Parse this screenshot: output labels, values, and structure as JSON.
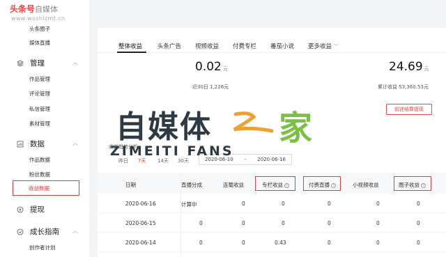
{
  "brand": {
    "logo": "头条号",
    "rest": "自媒体",
    "site": "www.woshizmt.cn"
  },
  "sidebar": {
    "top_items": [
      "头条圈子",
      "媒体直播"
    ],
    "groups": [
      {
        "label": "管理",
        "icon": "layers-icon",
        "items": [
          "作品管理",
          "评论管理",
          "私信管理",
          "素材管理"
        ]
      },
      {
        "label": "数据",
        "icon": "chart-icon",
        "items": [
          "作品数据",
          "粉丝数据",
          "收益数据"
        ]
      },
      {
        "label": "提现",
        "icon": "money-icon",
        "items": []
      },
      {
        "label": "成长指南",
        "icon": "growth-icon",
        "items": [
          "创作者计划"
        ]
      }
    ],
    "active_item": "收益数据"
  },
  "tabs": [
    "整体收益",
    "头条广告",
    "视频收益",
    "付费专栏",
    "番茄小说",
    "更多收益"
  ],
  "stats": {
    "left_value": "0.02",
    "left_unit": "元",
    "left_sub": "近30日 1,226元",
    "right_value": "24.69",
    "right_unit": "元",
    "right_sub": "累计收益 53,360.53元",
    "withdraw_button": "前往结算提现"
  },
  "watermark": {
    "cn": "自媒体",
    "zhi": "之",
    "jia": "家",
    "en": "ZIMEITI FANS"
  },
  "trend": {
    "title": "收益趋势分析",
    "ranges": [
      "昨日",
      "7天",
      "14天",
      "30天"
    ],
    "date_from": "2020-06-10",
    "date_sep": "-",
    "date_to": "2020-06-16"
  },
  "table": {
    "headers": [
      "日期",
      "直播分成",
      "连载收益",
      "专栏收益",
      "付费直播",
      "小视频收益",
      "圈子收益"
    ],
    "rows": [
      [
        "2020-06-16",
        "计算中",
        "0",
        "0",
        "0",
        "0",
        "0"
      ],
      [
        "2020-06-15",
        "0",
        "0",
        "0",
        "0",
        "0",
        "0"
      ],
      [
        "2020-06-14",
        "0",
        "0",
        "0.43",
        "0",
        "0",
        "0"
      ]
    ]
  },
  "colors": {
    "accent": "#e23a3a",
    "watermark_dark": "#2d3a44",
    "watermark_green": "#7ac043",
    "watermark_orange": "#f0a030"
  }
}
